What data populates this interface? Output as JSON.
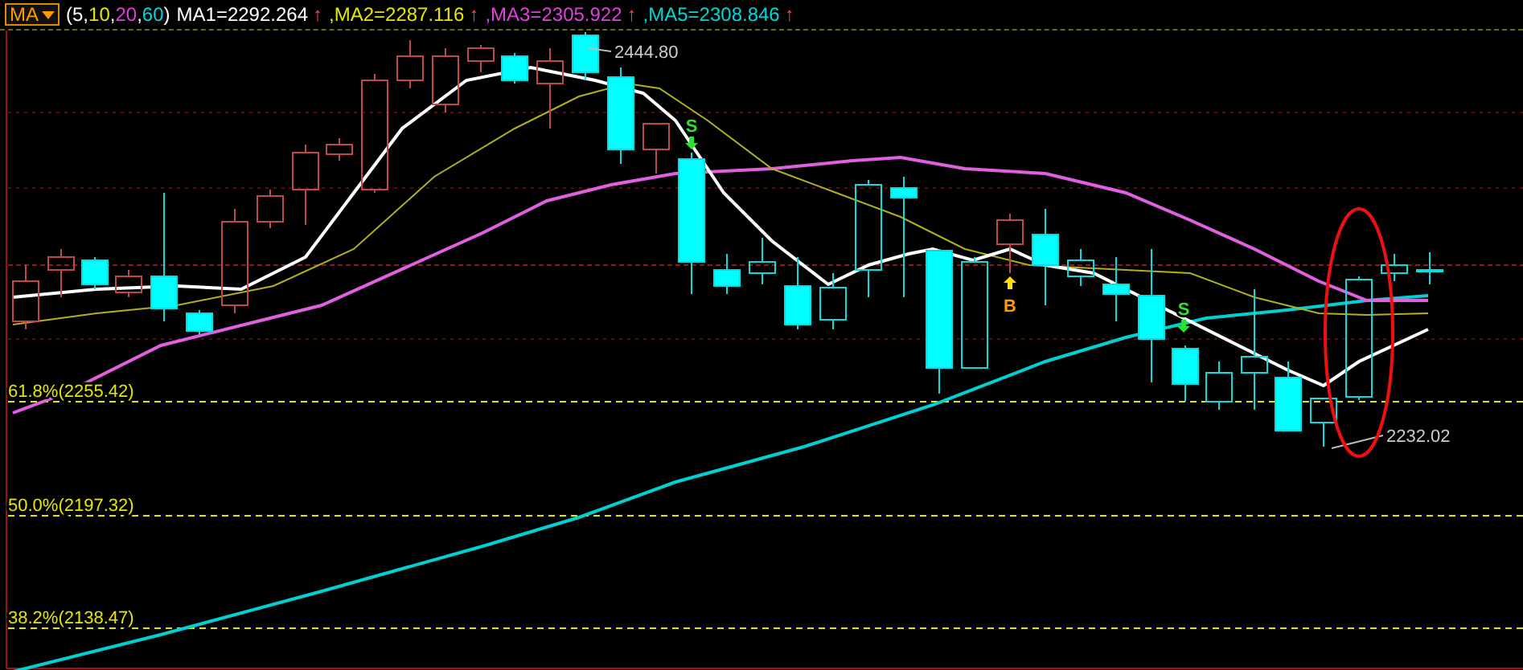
{
  "indicator": {
    "name": "MA",
    "params": [
      {
        "text": "(5",
        "color": "#ffffff"
      },
      {
        "text": ",",
        "color": "#ffffff"
      },
      {
        "text": "10",
        "color": "#e6e600"
      },
      {
        "text": ",",
        "color": "#ffffff"
      },
      {
        "text": "20",
        "color": "#e040e0"
      },
      {
        "text": ",",
        "color": "#ffffff"
      },
      {
        "text": "60",
        "color": "#00d8d8"
      },
      {
        "text": ")",
        "color": "#ffffff"
      }
    ]
  },
  "ma_values": [
    {
      "label": "MA1=2292.264",
      "color": "#ffffff",
      "trend": "↑"
    },
    {
      "label": ",MA2=2287.116",
      "color": "#e6e600",
      "trend": "↑"
    },
    {
      "label": ",MA3=2305.922",
      "color": "#e040e0",
      "trend": "↑"
    },
    {
      "label": ",MA5=2308.846",
      "color": "#00d8d8",
      "trend": "↑"
    }
  ],
  "chart": {
    "price_labels": [
      "2444.80",
      "2232.02"
    ],
    "fibonacci_levels": [
      "61.8%(2255.42)",
      "50.0%(2197.32)",
      "38.2%(2138.47)"
    ],
    "signals": [
      {
        "kind": "sell",
        "label": "S"
      },
      {
        "kind": "buy",
        "label": "B"
      },
      {
        "kind": "sell",
        "label": "S"
      }
    ]
  }
}
